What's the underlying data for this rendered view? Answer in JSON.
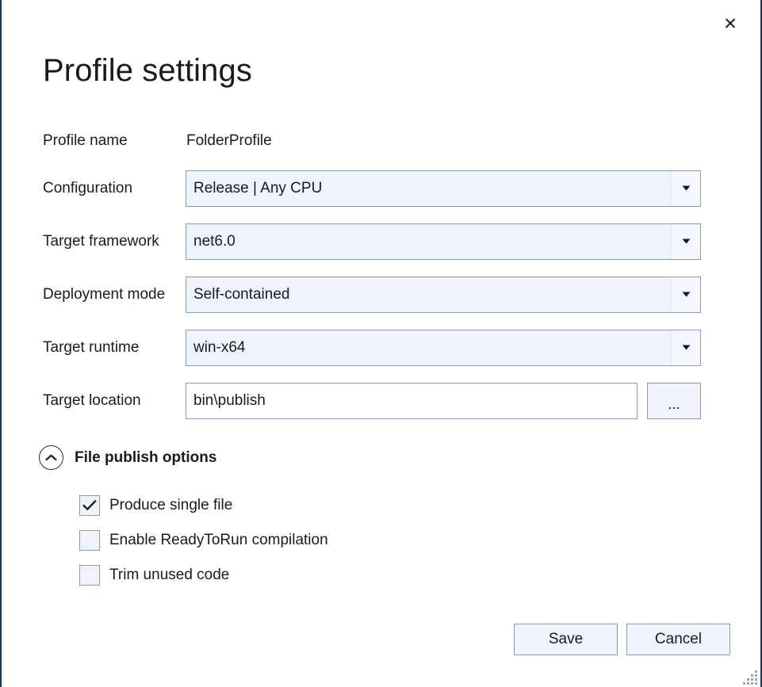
{
  "dialog": {
    "title": "Profile settings",
    "close_label": "✕",
    "close_icon": "close-icon",
    "border_color": "#1e3356"
  },
  "form": {
    "rows": [
      {
        "label": "Profile name",
        "type": "static",
        "value": "FolderProfile"
      },
      {
        "label": "Configuration",
        "type": "combo",
        "value": "Release | Any CPU"
      },
      {
        "label": "Target framework",
        "type": "combo",
        "value": "net6.0"
      },
      {
        "label": "Deployment mode",
        "type": "combo",
        "value": "Self-contained"
      },
      {
        "label": "Target runtime",
        "type": "combo",
        "value": "win-x64"
      },
      {
        "label": "Target location",
        "type": "text",
        "value": "bin\\publish",
        "browse_label": "..."
      }
    ]
  },
  "publish_options": {
    "expander_label": "File publish options",
    "expander_icon": "chevron-up-icon",
    "expanded": true,
    "items": [
      {
        "label": "Produce single file",
        "checked": true
      },
      {
        "label": "Enable ReadyToRun compilation",
        "checked": false
      },
      {
        "label": "Trim unused code",
        "checked": false
      }
    ]
  },
  "footer": {
    "save_label": "Save",
    "cancel_label": "Cancel"
  },
  "colors": {
    "control_fill": "#eff3fb",
    "control_border": "#8f9aa8",
    "text": "#1b1b1b",
    "window_border": "#1e3356"
  }
}
